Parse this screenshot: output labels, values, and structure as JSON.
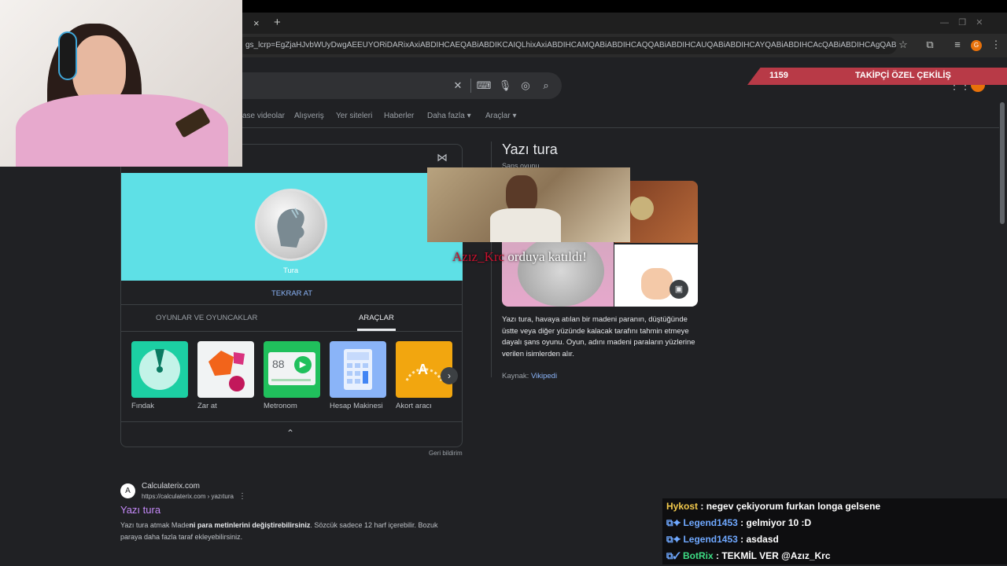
{
  "browser": {
    "url": "gs_lcrp=EgZjaHJvbWUyDwgAEEUYORiDARixAxiABDIHCAEQABiABDIKCAIQLhixAxiABDIHCAMQABiABDIHCAQQABiABDIHCAUQABiABDIHCAYQABiABDIHCAcQABiABDIHCAgQABiABDIHCAkQABiABNIB...",
    "tab_close": "×",
    "tab_new": "+",
    "profile_initial": "G"
  },
  "search": {
    "filters": [
      "ase videolar",
      "Alışveriş",
      "Yer siteleri",
      "Haberler",
      "Daha fazla ▾",
      "Araçlar ▾"
    ]
  },
  "coin_widget": {
    "result_label": "Tura",
    "flip_again": "TEKRAR AT",
    "tabs": [
      "OYUNLAR VE OYUNCAKLAR",
      "ARAÇLAR"
    ],
    "tools": [
      {
        "label": "Fındak",
        "color": "#1ccfa3"
      },
      {
        "label": "Zar at",
        "color": "#f1f3f4"
      },
      {
        "label": "Metronom",
        "color": "#20c05c"
      },
      {
        "label": "Hesap Makinesi",
        "color": "#8ab4f8"
      },
      {
        "label": "Akort aracı",
        "color": "#f2a60f"
      }
    ],
    "metronome_value": "88",
    "tuner_letter": "A",
    "feedback": "Geri bildirim"
  },
  "knowledge_panel": {
    "title": "Yazı tura",
    "subtitle": "Şans oyunu",
    "description": "Yazı tura, havaya atılan bir madeni paranın, düştüğünde üstte veya diğer yüzünde kalacak tarafını tahmin etmeye dayalı şans oyunu. Oyun, adını madeni paraların yüzlerine verilen isimlerden alır.",
    "source_label": "Kaynak:",
    "source_link": "Vikipedi"
  },
  "result": {
    "site": "Calculaterix.com",
    "url": "https://calculaterix.com › yazıtura",
    "title": "Yazı tura",
    "snippet_pre": "Yazı tura atmak Made",
    "snippet_bold": "ni para metinlerini değiştirebilirsiniz",
    "snippet_post": ". Sözcük sadece 12 harf içerebilir. Bozuk paraya daha fazla taraf ekleyebilirsiniz."
  },
  "stream": {
    "alert_user": "Azız_Krc",
    "alert_text": " orduya katıldı!",
    "banner_count": "1159",
    "banner_title": "TAKİPÇİ ÖZEL ÇEKİLİŞ",
    "chat": [
      {
        "user": "Hykost",
        "color": "#f2c94c",
        "msg": ": negev çekiyorum furkan longa gelsene"
      },
      {
        "user": "Legend1453",
        "color": "#6fa8ff",
        "msg": ": gelmiyor 10 :D"
      },
      {
        "user": "Legend1453",
        "color": "#6fa8ff",
        "msg": ": asdasd"
      },
      {
        "user": "BotRix",
        "color": "#3ddc84",
        "msg": ": TEKMİL VER @Azız_Krc"
      }
    ]
  }
}
